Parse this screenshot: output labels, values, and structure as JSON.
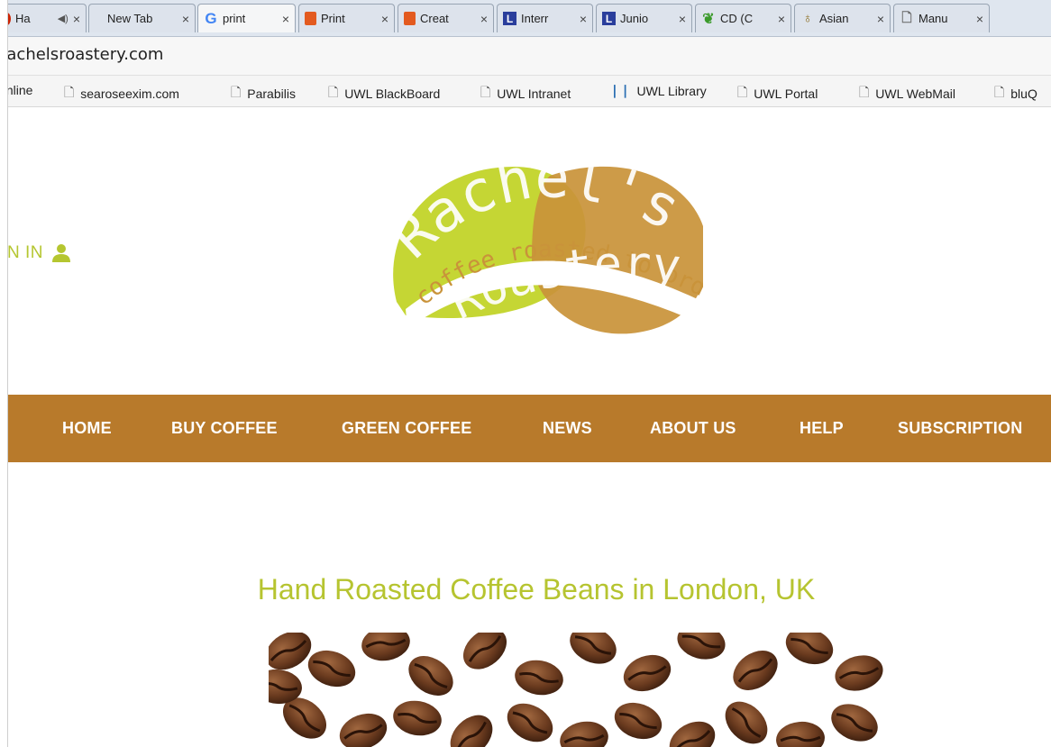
{
  "browser": {
    "tabs": [
      {
        "icon": "red-dot",
        "label": "Ha",
        "close": "×",
        "extra": "◀)"
      },
      {
        "icon": "",
        "label": "New Tab",
        "close": "×"
      },
      {
        "icon": "google",
        "label": "print",
        "close": "×"
      },
      {
        "icon": "office",
        "label": "Print",
        "close": "×"
      },
      {
        "icon": "office",
        "label": "Creat",
        "close": "×"
      },
      {
        "icon": "lblue",
        "label": "Interr",
        "close": "×"
      },
      {
        "icon": "lblue",
        "label": "Junio",
        "close": "×"
      },
      {
        "icon": "cd",
        "label": "CD (C",
        "close": "×"
      },
      {
        "icon": "bulb",
        "label": "Asian",
        "close": "×"
      },
      {
        "icon": "page",
        "label": "Manu",
        "close": "×"
      }
    ],
    "address": "rachelsroastery.com",
    "bookmarks": [
      {
        "label": "Online",
        "icon": ""
      },
      {
        "label": "searoseexim.com",
        "icon": "page-icon"
      },
      {
        "label": "Parabilis",
        "icon": "page-icon"
      },
      {
        "label": "UWL BlackBoard",
        "icon": "page-icon"
      },
      {
        "label": "UWL Intranet",
        "icon": "page-icon"
      },
      {
        "label": "UWL Library",
        "icon": "library-icon"
      },
      {
        "label": "UWL Portal",
        "icon": "page-icon"
      },
      {
        "label": "UWL WebMail",
        "icon": "page-icon"
      },
      {
        "label": "bluQ",
        "icon": "page-icon"
      }
    ]
  },
  "header": {
    "signin_label": "N IN",
    "logo": {
      "brand_top": "Rachel's",
      "tagline": "coffee roasted to order",
      "brand_bottom": "Roastery",
      "color_green": "#c5d634",
      "color_brown": "#c9933a"
    }
  },
  "nav": {
    "items": [
      "HOME",
      "BUY COFFEE",
      "GREEN COFFEE",
      "NEWS",
      "ABOUT US",
      "HELP",
      "SUBSCRIPTION"
    ],
    "color": "#b87a2b"
  },
  "main": {
    "heading": "Hand Roasted Coffee Beans in London, UK",
    "heading_color": "#b6c430"
  }
}
